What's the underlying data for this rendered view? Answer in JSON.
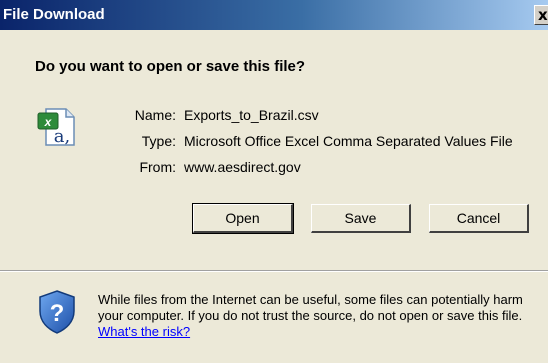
{
  "window": {
    "title": "File Download",
    "close_glyph": "x"
  },
  "dialog": {
    "heading": "Do you want to open or save this file?",
    "file_icon": "excel-csv-file-icon",
    "info": {
      "name_label": "Name:",
      "name_value": "Exports_to_Brazil.csv",
      "type_label": "Type:",
      "type_value": "Microsoft Office Excel Comma Separated Values File",
      "from_label": "From:",
      "from_value": "www.aesdirect.gov"
    },
    "buttons": {
      "open": "Open",
      "save": "Save",
      "cancel": "Cancel"
    },
    "warning": {
      "icon": "security-shield-question-icon",
      "text": "While files from the Internet can be useful, some files can potentially harm your computer. If you do not trust the source, do not open or save this file.",
      "link": "What's the risk?"
    }
  },
  "colors": {
    "title_bar_start": "#0a246a",
    "title_bar_end": "#a6caf0",
    "dialog_background": "#ece9d8",
    "link": "#0000ff"
  }
}
